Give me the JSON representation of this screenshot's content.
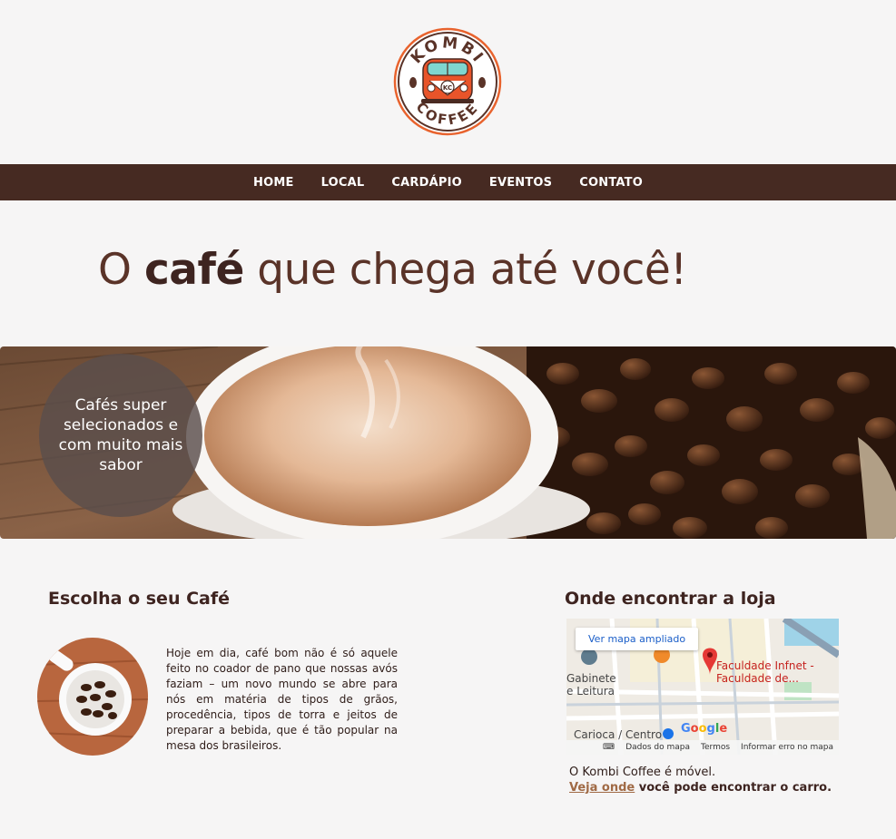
{
  "logo": {
    "top_text": "KOMBI",
    "bottom_text": "COFFEE",
    "badge_text": "KC"
  },
  "nav": {
    "items": [
      {
        "label": "HOME"
      },
      {
        "label": "LOCAL"
      },
      {
        "label": "CARDÁPIO"
      },
      {
        "label": "EVENTOS"
      },
      {
        "label": "CONTATO"
      }
    ]
  },
  "hero": {
    "prefix": "O ",
    "bold": "café",
    "suffix": " que chega até você!"
  },
  "banner": {
    "badge_text": "Cafés super selecionados e com muito mais sabor"
  },
  "choose": {
    "title": "Escolha o seu Café",
    "paragraph": "Hoje em dia, café bom não é só aquele feito no coador de pano que nossas avós faziam – um novo mundo se abre para nós em matéria de tipos de grãos, procedência, tipos de torra e jeitos de preparar a bebida, que é tão popular na mesa dos brasileiros."
  },
  "where": {
    "title": "Onde encontrar a loja",
    "map": {
      "button": "Ver mapa ampliado",
      "place_line1": "Faculdade Infnet -",
      "place_line2": "Faculdade de...",
      "label_gabinete_1": "Gabinete",
      "label_gabinete_2": "e Leitura",
      "label_carioca": "Carioca / Centro",
      "google": "Google",
      "footer_data": "Dados do mapa",
      "footer_terms": "Termos",
      "footer_report": "Informar erro no mapa"
    },
    "mobile_text": "O Kombi Coffee é móvel.",
    "link_text": "Veja onde",
    "after_link": " você pode encontrar o carro."
  },
  "colors": {
    "nav_bg": "#462a22",
    "title": "#5a3328",
    "link": "#a06a45",
    "logo_orange": "#e8542a",
    "logo_mint": "#7fd6cf"
  }
}
